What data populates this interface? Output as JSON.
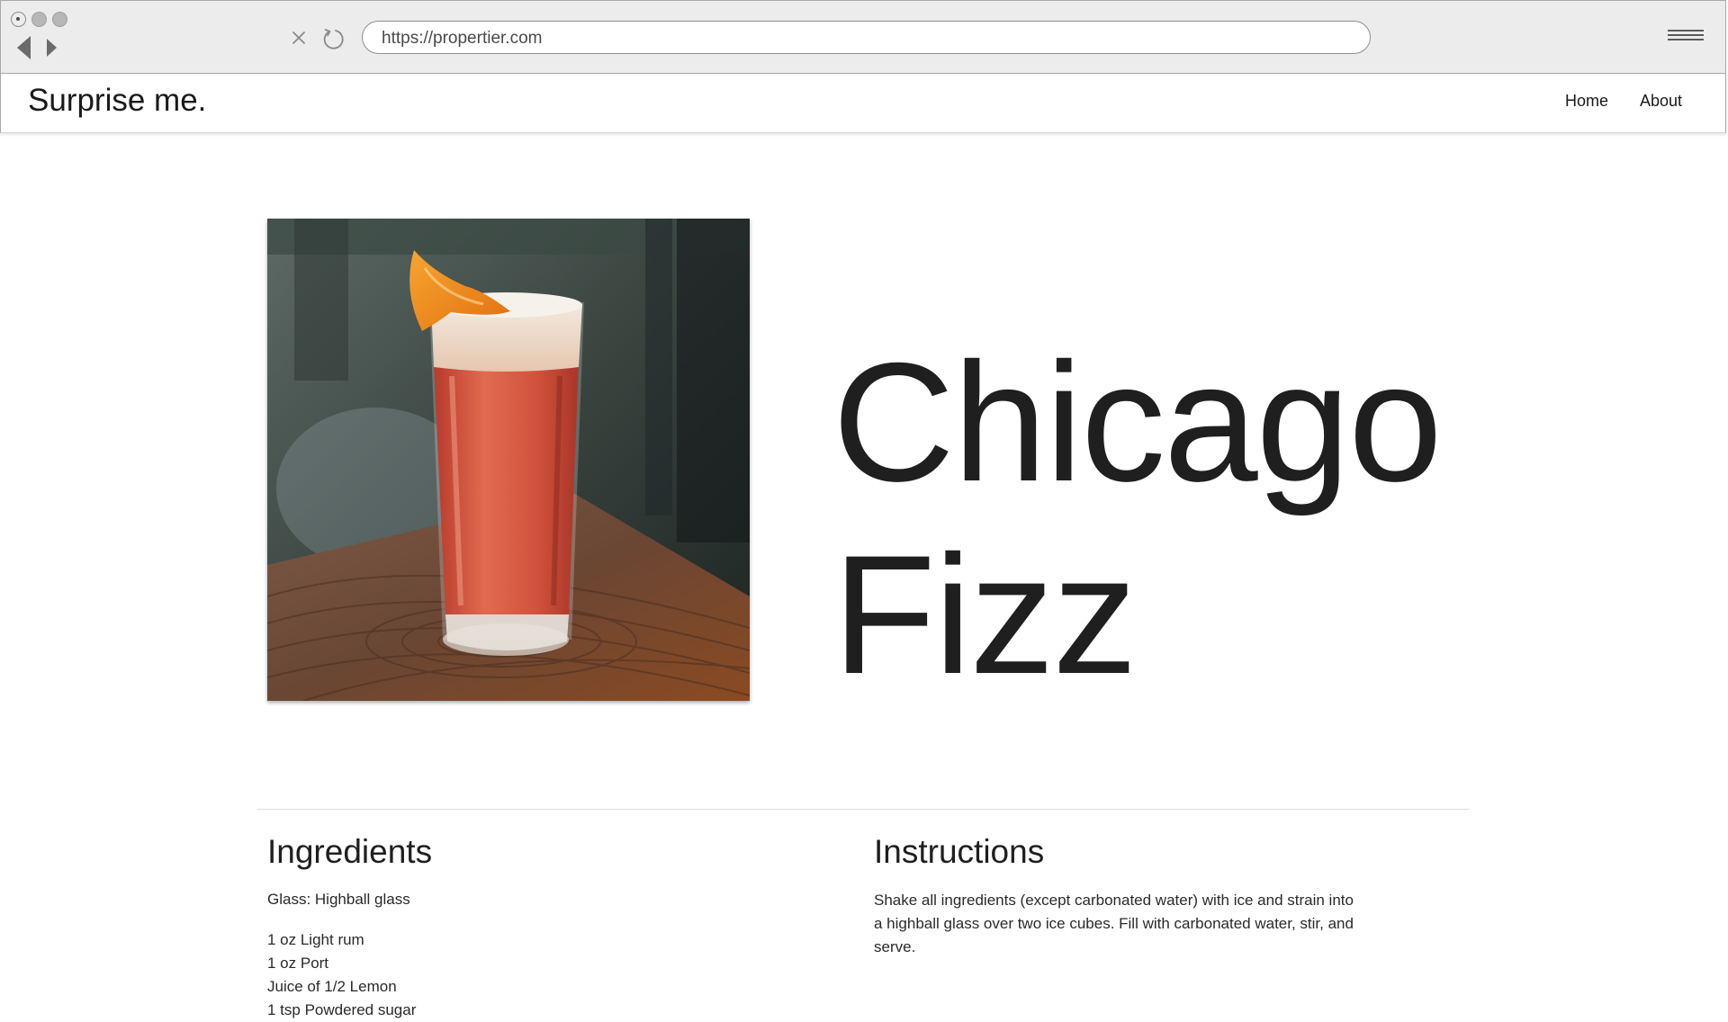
{
  "browser": {
    "url": "https://propertier.com",
    "controls": {
      "back_icon": "back-arrow-icon",
      "forward_icon": "forward-arrow-icon",
      "stop_icon": "close-x-icon",
      "reload_icon": "reload-icon",
      "menu_icon": "hamburger-menu-icon"
    }
  },
  "site": {
    "brand": "Surprise me.",
    "nav": [
      {
        "label": "Home"
      },
      {
        "label": "About"
      }
    ]
  },
  "drink": {
    "name_line1": "Chicago",
    "name_line2": "Fizz",
    "photo": "cocktail-photo"
  },
  "ingredients": {
    "heading": "Ingredients",
    "glass": "Glass: Highball glass",
    "items": [
      "1 oz Light rum",
      "1 oz Port",
      "Juice of 1/2 Lemon",
      "1 tsp Powdered sugar"
    ]
  },
  "instructions": {
    "heading": "Instructions",
    "text": "Shake all ingredients (except carbonated water) with ice and strain into a highball glass over two ice cubes. Fill with carbonated water, stir, and serve."
  },
  "colors": {
    "chrome_bg": "#ececec",
    "text": "#1f1f1f",
    "drink": "#d4533e",
    "garnish": "#f08a1c"
  }
}
